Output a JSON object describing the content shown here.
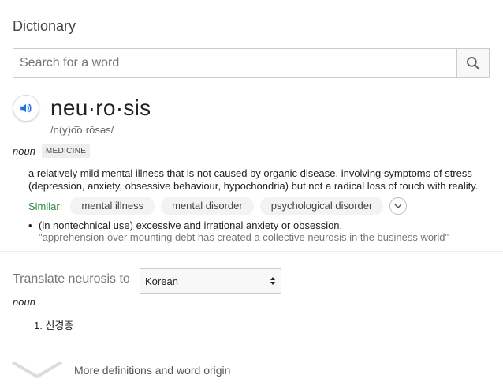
{
  "header": {
    "title": "Dictionary"
  },
  "search": {
    "placeholder": "Search for a word",
    "value": ""
  },
  "entry": {
    "headword": "neu·ro·sis",
    "phonetic": "/n(y)o͝oˈrōsəs/",
    "pos": "noun",
    "label": "MEDICINE",
    "definition": "a relatively mild mental illness that is not caused by organic disease, involving symptoms of stress (depression, anxiety, obsessive behaviour, hypochondria) but not a radical loss of touch with reality.",
    "similar_label": "Similar:",
    "similar": [
      "mental illness",
      "mental disorder",
      "psychological disorder"
    ],
    "sense2": {
      "bullet": "•",
      "text": "(in nontechnical use) excessive and irrational anxiety or obsession.",
      "example": "\"apprehension over mounting debt has created a collective neurosis in the business world\""
    }
  },
  "translate": {
    "label": "Translate neurosis to",
    "language": "Korean",
    "pos": "noun",
    "items": [
      "1. 신경증"
    ]
  },
  "footer": {
    "more_label": "More definitions and word origin"
  },
  "icons": {
    "search": "search-icon",
    "speaker": "speaker-icon",
    "expand": "chevron-down-icon",
    "select_arrows": "select-arrows-icon",
    "more": "chevron-down-icon"
  },
  "colors": {
    "speaker_blue": "#1a73e8",
    "similar_green": "#2e8b46",
    "chip_bg": "#f1f3f4"
  }
}
